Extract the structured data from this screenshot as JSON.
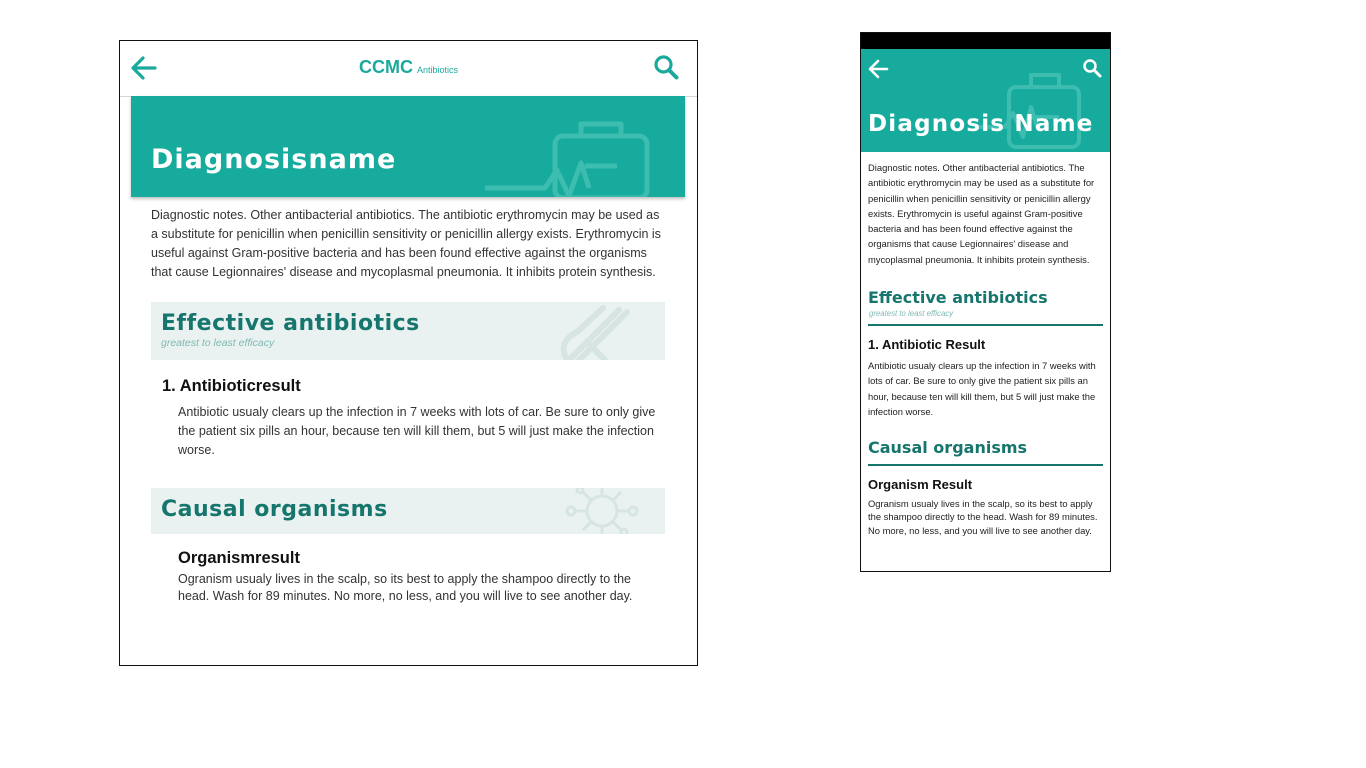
{
  "colors": {
    "accent": "#17ab9e",
    "dark_accent": "#16766d",
    "section_bg": "#e9f2f0"
  },
  "tablet": {
    "topbar": {
      "app_name": "CCMC",
      "subtitle": "Antibiotics",
      "back_icon": "arrow-left-icon",
      "search_icon": "search-icon"
    },
    "hero": {
      "title": "Diagnosisname",
      "icon": "medical-kit-icon"
    },
    "notes": "Diagnostic notes. Other antibacterial antibiotics. The antibiotic erythromycin may be used as a substitute for penicillin when penicillin sensitivity or penicillin allergy exists. Erythromycin is useful against Gram-positive bacteria and has been found effective against the organisms that cause Legionnaires' disease and mycoplasmal pneumonia. It inhibits protein synthesis.",
    "effective": {
      "heading": "Effective antibiotics",
      "caption": "greatest to least efficacy",
      "icon": "pill-capsule-icon",
      "result_title": "1. Antibioticresult",
      "result_text": "Antibiotic usualy clears up the infection in 7 weeks with lots of car. Be sure to only give the patient six pills an hour, because ten will kill them, but 5 will just make the infection worse."
    },
    "causal": {
      "heading": "Causal organisms",
      "icon": "virus-icon",
      "result_title": "Organismresult",
      "result_text": "Ogranism usualy lives in the scalp, so its best to apply the shampoo directly to the head. Wash for 89 minutes. No more, no less, and you will live to see another day."
    }
  },
  "phone": {
    "header": {
      "back_icon": "arrow-left-icon",
      "search_icon": "search-icon",
      "title": "Diagnosis Name"
    },
    "notes": "Diagnostic notes. Other antibacterial antibiotics. The antibiotic erythromycin may be used as a substitute for penicillin when penicillin sensitivity or penicillin allergy exists. Erythromycin is useful against Gram-positive bacteria and has been found effective against the organisms that cause Legionnaires' disease and mycoplasmal pneumonia. It inhibits protein synthesis.",
    "effective": {
      "heading": "Effective antibiotics",
      "caption": "greatest to least efficacy",
      "result_title": "1. Antibiotic Result",
      "result_text": "Antibiotic usualy clears up the infection in 7 weeks with lots of car. Be sure to only give the patient six pills an hour, because ten will kill them, but 5 will just make the infection worse."
    },
    "causal": {
      "heading": "Causal organisms",
      "result_title": "Organism Result",
      "result_text": "Ogranism usualy lives in the scalp, so its best to apply the shampoo directly to the head. Wash for 89 minutes. No more, no less, and you will live to see another day."
    }
  }
}
